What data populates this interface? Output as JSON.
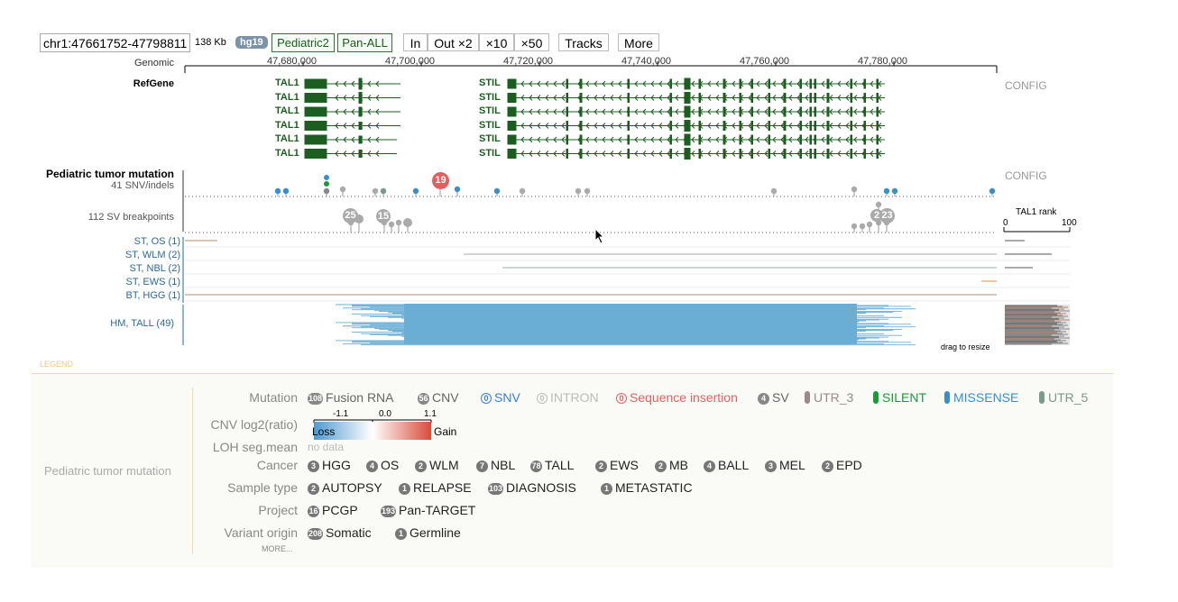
{
  "toolbar": {
    "coord_value": "chr1:47661752-47798811",
    "size": "138 Kb",
    "genome": "hg19",
    "datasets": [
      "Pediatric2",
      "Pan-ALL"
    ],
    "zoom_in": "In",
    "zoom_out2": "Out ×2",
    "zoom_x10": "×10",
    "zoom_x50": "×50",
    "tracks": "Tracks",
    "more": "More"
  },
  "ruler": {
    "label": "Genomic",
    "ticks": [
      "47,680,000",
      "47,700,000",
      "47,720,000",
      "47,740,000",
      "47,760,000",
      "47,780,000"
    ]
  },
  "refgene": {
    "label": "RefGene",
    "config": "CONFIG",
    "genes_left": [
      "TAL1",
      "TAL1",
      "TAL1",
      "TAL1",
      "TAL1",
      "TAL1"
    ],
    "genes_right": [
      "STIL",
      "STIL",
      "STIL",
      "STIL",
      "STIL",
      "STIL"
    ]
  },
  "mutation": {
    "title": "Pediatric tumor mutation",
    "config": "CONFIG",
    "snv_label": "41 SNV/indels",
    "sv_label": "112 SV breakpoints",
    "snv_bubble": "19",
    "sv_bubbles": [
      "25",
      "15",
      "2",
      "23"
    ],
    "rank_title": "TAL1 rank",
    "rank_min": "0",
    "rank_max": "100",
    "cohorts": [
      "ST, OS (1)",
      "ST, WLM (2)",
      "ST, NBL (2)",
      "ST, EWS (1)",
      "BT, HGG (1)",
      "HM, TALL (49)"
    ],
    "drag_hint": "drag to resize"
  },
  "legend": {
    "title": "LEGEND",
    "track_name": "Pediatric tumor mutation",
    "rows": {
      "mutation": "Mutation",
      "cnv": "CNV log2(ratio)",
      "loh": "LOH seg.mean",
      "cancer": "Cancer",
      "sample_type": "Sample type",
      "project": "Project",
      "variant_origin": "Variant origin"
    },
    "mutation_items": [
      {
        "count": "108",
        "label": "Fusion RNA"
      },
      {
        "count": "56",
        "label": "CNV"
      },
      {
        "count": "0",
        "label": "SNV"
      },
      {
        "count": "0",
        "label": "INTRON"
      },
      {
        "count": "0",
        "label": "Sequence insertion"
      },
      {
        "count": "4",
        "label": "SV"
      },
      {
        "label": "UTR_3"
      },
      {
        "label": "SILENT"
      },
      {
        "label": "MISSENSE"
      },
      {
        "label": "UTR_5"
      }
    ],
    "colors": {
      "snv": "#3b7fe0",
      "intron": "#bbbbbb",
      "insertion": "#e06060",
      "utr3": "#9a8a8a",
      "silent": "#1a9a3a",
      "missense": "#3a8fc8",
      "utr5": "#7a9a8a"
    },
    "cnv_scale": {
      "min": "-1.1",
      "mid": "0.0",
      "max": "1.1",
      "loss": "Loss",
      "gain": "Gain"
    },
    "loh_value": "no data",
    "cancer_items": [
      {
        "count": "3",
        "label": "HGG"
      },
      {
        "count": "4",
        "label": "OS"
      },
      {
        "count": "2",
        "label": "WLM"
      },
      {
        "count": "7",
        "label": "NBL"
      },
      {
        "count": "78",
        "label": "TALL"
      },
      {
        "count": "2",
        "label": "EWS"
      },
      {
        "count": "2",
        "label": "MB"
      },
      {
        "count": "4",
        "label": "BALL"
      },
      {
        "count": "3",
        "label": "MEL"
      },
      {
        "count": "2",
        "label": "EPD"
      }
    ],
    "sample_items": [
      {
        "count": "2",
        "label": "AUTOPSY"
      },
      {
        "count": "1",
        "label": "RELAPSE"
      },
      {
        "count": "103",
        "label": "DIAGNOSIS"
      },
      {
        "count": "1",
        "label": "METASTATIC"
      }
    ],
    "project_items": [
      {
        "count": "16",
        "label": "PCGP"
      },
      {
        "count": "193",
        "label": "Pan-TARGET"
      }
    ],
    "origin_items": [
      {
        "count": "208",
        "label": "Somatic"
      },
      {
        "count": "1",
        "label": "Germline"
      }
    ],
    "more": "MORE..."
  }
}
